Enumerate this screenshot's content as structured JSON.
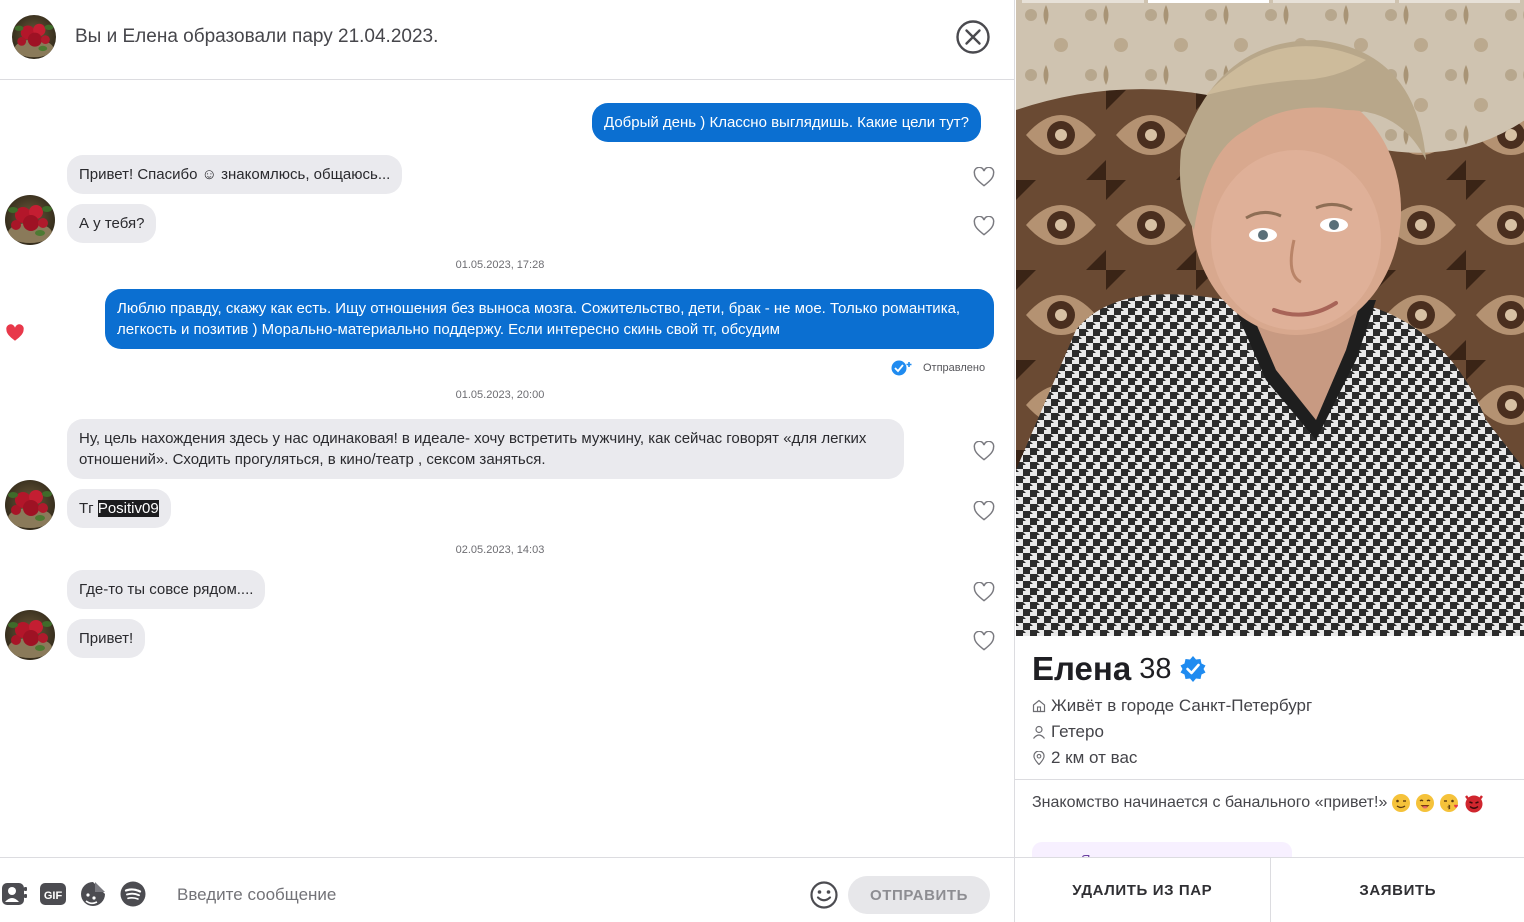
{
  "header": {
    "title": "Вы и Елена образовали пару 21.04.2023."
  },
  "messages": [
    {
      "direction": "out",
      "text": "Добрый день ) Классно выглядишь. Какие цели тут?"
    },
    {
      "direction": "in",
      "text": "Привет! Спасибо ☺ знакомлюсь, общаюсь..."
    },
    {
      "direction": "in",
      "text": "А у тебя?"
    },
    {
      "timestamp": "01.05.2023, 17:28"
    },
    {
      "direction": "out",
      "text": "Люблю правду, скажу как есть. Ищу отношения без выноса мозга. Сожительство, дети, брак - не мое. Только романтика, легкость и позитив ) Морально-материально поддержу. Если интересно скинь свой тг, обсудим",
      "liked": true,
      "status": "Отправлено"
    },
    {
      "timestamp": "01.05.2023, 20:00"
    },
    {
      "direction": "in",
      "text": "Ну, цель нахождения здесь у нас одинаковая! в идеале- хочу встретить мужчину, как сейчас говорят «для легких отношений». Сходить прогуляться, в кино/театр , сексом заняться."
    },
    {
      "direction": "in",
      "prefix": "Тг ",
      "selected": "Positiv09"
    },
    {
      "timestamp": "02.05.2023, 14:03"
    },
    {
      "direction": "in",
      "text": "Где-то ты совсе рядом...."
    },
    {
      "direction": "in",
      "text": "Привет!"
    }
  ],
  "composer": {
    "placeholder": "Введите сообщение",
    "send_label": "ОТПРАВИТЬ",
    "gif_label": "GIF",
    "tools": [
      "contact-card-icon",
      "gif-icon",
      "sticker-icon",
      "spotify-icon",
      "emoji-icon"
    ]
  },
  "profile": {
    "name": "Елена",
    "age": "38",
    "verified": true,
    "city": "Живёт в городе Санкт-Петербург",
    "orientation": "Гетеро",
    "distance": "2 км от вас",
    "bio": "Знакомство начинается с банального «привет!»",
    "bio_emojis": [
      "winking-face",
      "smiling-face",
      "kissing-face",
      "smiling-devil"
    ],
    "card_peek_text": "Я ищу",
    "photo_count": 4,
    "active_photo": 2,
    "actions": {
      "unmatch": "УДАЛИТЬ ИЗ ПАР",
      "report": "ЗАЯВИТЬ"
    }
  },
  "colors": {
    "outgoing_bubble": "#0b6fd1",
    "incoming_bubble": "#eaeaee",
    "like_heart": "#e8384a",
    "verified_badge": "#1f8bf0"
  }
}
